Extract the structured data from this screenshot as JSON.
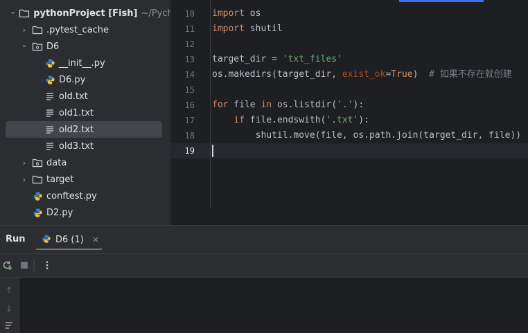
{
  "project_tree": [
    {
      "label": "pythonProject [Fish]",
      "path": "~/Pycharm",
      "type": "root",
      "expanded": true
    },
    {
      "label": ".pytest_cache",
      "type": "folder",
      "expanded": false
    },
    {
      "label": "D6",
      "type": "package",
      "expanded": true
    },
    {
      "label": "__init__.py",
      "type": "python"
    },
    {
      "label": "D6.py",
      "type": "python"
    },
    {
      "label": "old.txt",
      "type": "text"
    },
    {
      "label": "old1.txt",
      "type": "text"
    },
    {
      "label": "old2.txt",
      "type": "text",
      "selected": true
    },
    {
      "label": "old3.txt",
      "type": "text"
    },
    {
      "label": "data",
      "type": "package",
      "expanded": false
    },
    {
      "label": "target",
      "type": "folder",
      "expanded": false
    },
    {
      "label": "conftest.py",
      "type": "python"
    },
    {
      "label": "D2.py",
      "type": "python"
    }
  ],
  "editor": {
    "line_numbers": [
      "10",
      "11",
      "12",
      "13",
      "14",
      "15",
      "16",
      "17",
      "18",
      "19"
    ],
    "current_line": "19",
    "code": [
      [
        {
          "t": "import",
          "c": "kw"
        },
        {
          "t": " os",
          "c": ""
        }
      ],
      [
        {
          "t": "import",
          "c": "kw"
        },
        {
          "t": " shutil",
          "c": ""
        }
      ],
      [],
      [
        {
          "t": "target_dir = ",
          "c": ""
        },
        {
          "t": "'txt_files'",
          "c": "str"
        }
      ],
      [
        {
          "t": "os.makedirs(target_dir, ",
          "c": ""
        },
        {
          "t": "exist_ok",
          "c": "param"
        },
        {
          "t": "=",
          "c": ""
        },
        {
          "t": "True",
          "c": "kw"
        },
        {
          "t": ")  ",
          "c": ""
        },
        {
          "t": "# 如果不存在就创建",
          "c": "cmt"
        }
      ],
      [],
      [
        {
          "t": "for",
          "c": "kw"
        },
        {
          "t": " file ",
          "c": ""
        },
        {
          "t": "in",
          "c": "kw"
        },
        {
          "t": " os.listdir(",
          "c": ""
        },
        {
          "t": "'.'",
          "c": "str"
        },
        {
          "t": "):",
          "c": ""
        }
      ],
      [
        {
          "t": "    ",
          "c": ""
        },
        {
          "t": "if",
          "c": "kw"
        },
        {
          "t": " file.endswith(",
          "c": ""
        },
        {
          "t": "'.txt'",
          "c": "str"
        },
        {
          "t": "):",
          "c": ""
        }
      ],
      [
        {
          "t": "        shutil.move(file, os.path.join(target_dir, file))",
          "c": ""
        }
      ],
      []
    ]
  },
  "run_panel": {
    "title": "Run",
    "tab_label": "D6 (1)",
    "tab_close": "×"
  },
  "colors": {
    "accent": "#3574f0",
    "python_icon_blue": "#3d7bbf",
    "python_icon_yellow": "#f0c43a"
  }
}
